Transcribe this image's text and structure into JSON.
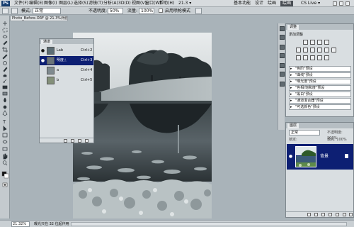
{
  "app": {
    "logo": "Ps",
    "menu": [
      "文件(F)",
      "编辑(E)",
      "图像(I)",
      "图层(L)",
      "选择(S)",
      "滤镜(T)",
      "分析(A)",
      "3D(D)",
      "视图(V)",
      "窗口(W)",
      "帮助(H)"
    ],
    "zoom_readout": "21.3 ▾",
    "workspaces": [
      "基本功能",
      "设计",
      "绘画"
    ],
    "active_workspace": "绘画",
    "cs_live": "CS Live ▾"
  },
  "options_bar": {
    "mode_label": "模式:",
    "mode_value": "正常",
    "opacity_label": "不透明度:",
    "opacity_value": "50%",
    "flow_label": "流量:",
    "flow_value": "100%",
    "airbrush_label": "启用喷枪模式"
  },
  "document": {
    "tab_title": "Photo_Before.ORF @ 21.3%(明度,8#) ×"
  },
  "channels_panel": {
    "tab_label": "通道",
    "channels": [
      {
        "name": "Lab",
        "shortcut": "Ctrl+2",
        "visible": true,
        "selected": false,
        "thumb_color": "#5c6d74"
      },
      {
        "name": "明度",
        "shortcut": "Ctrl+3",
        "visible": true,
        "selected": true,
        "thumb_color": "#6a7479"
      },
      {
        "name": "a",
        "shortcut": "Ctrl+4",
        "visible": false,
        "selected": false,
        "thumb_color": "#7f8a8f"
      },
      {
        "name": "b",
        "shortcut": "Ctrl+5",
        "visible": false,
        "selected": false,
        "thumb_color": "#84907a"
      }
    ]
  },
  "adjustments_panel": {
    "tab_label": "调整",
    "heading": "添加调整",
    "presets": [
      "\"色阶\"预设",
      "\"曲线\"预设",
      "\"曝光度\"预设",
      "\"色相/饱和度\"预设",
      "\"黑白\"预设",
      "\"通道混合器\"预设",
      "\"可选颜色\"预设"
    ]
  },
  "layers_panel": {
    "tab_label": "图层",
    "blend_mode": "正常",
    "opacity_label": "不透明度: 100%",
    "fill_label": "填充: 100%",
    "lock_label": "锁定:",
    "layers": [
      {
        "name": "背景",
        "locked": true,
        "visible": true,
        "selected": true
      }
    ]
  },
  "status_bar": {
    "zoom": "21.32%",
    "info": "曝光只在 32 位起作用"
  },
  "colors": {
    "selection": "#0d1f73",
    "workspace_bg": "#a9b3b9",
    "panel_bg": "#d9dee1"
  }
}
